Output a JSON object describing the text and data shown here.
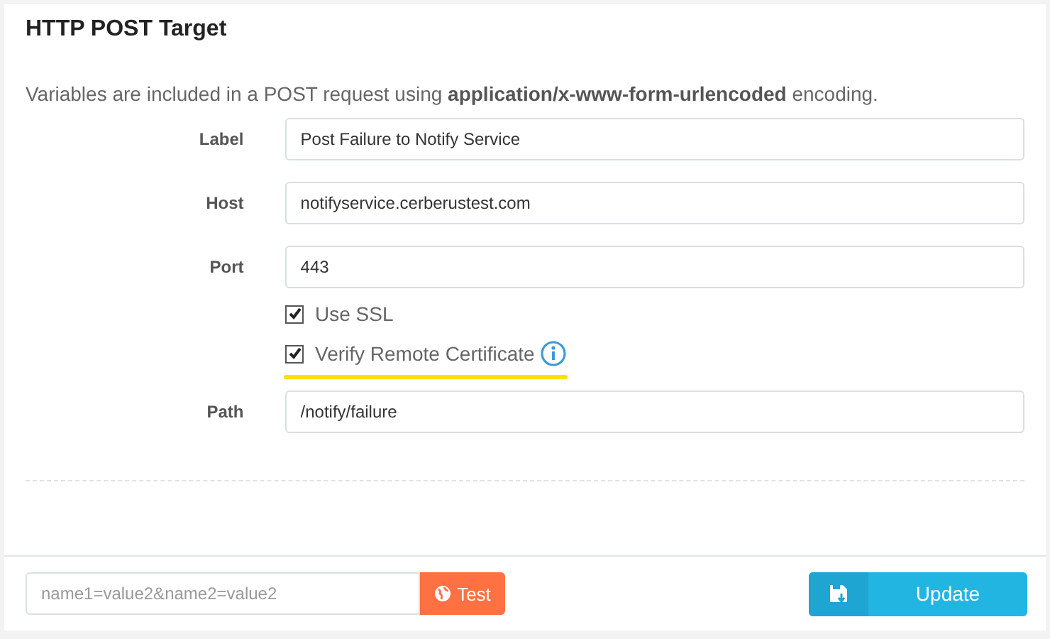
{
  "title": "HTTP POST Target",
  "description": "Variables are included in a POST request using **application/x-www-form-urlencoded** encoding.",
  "fields": [
    {
      "kind": "text",
      "label": "Label",
      "value": "Post Failure to Notify Service"
    },
    {
      "kind": "text",
      "label": "Host",
      "value": "notifyservice.cerberustest.com"
    },
    {
      "kind": "text",
      "label": "Port",
      "value": "443"
    },
    {
      "kind": "checks",
      "options": [
        {
          "label": "Use SSL",
          "checked": true,
          "highlighted": false,
          "info": false
        },
        {
          "label": "Verify Remote Certificate",
          "checked": true,
          "highlighted": true,
          "info": true
        }
      ]
    },
    {
      "kind": "text",
      "label": "Path",
      "value": "/notify/failure"
    }
  ],
  "footer": {
    "test_placeholder": "name1=value2&name2=value2",
    "test_button": "Test",
    "update_button": "Update"
  }
}
